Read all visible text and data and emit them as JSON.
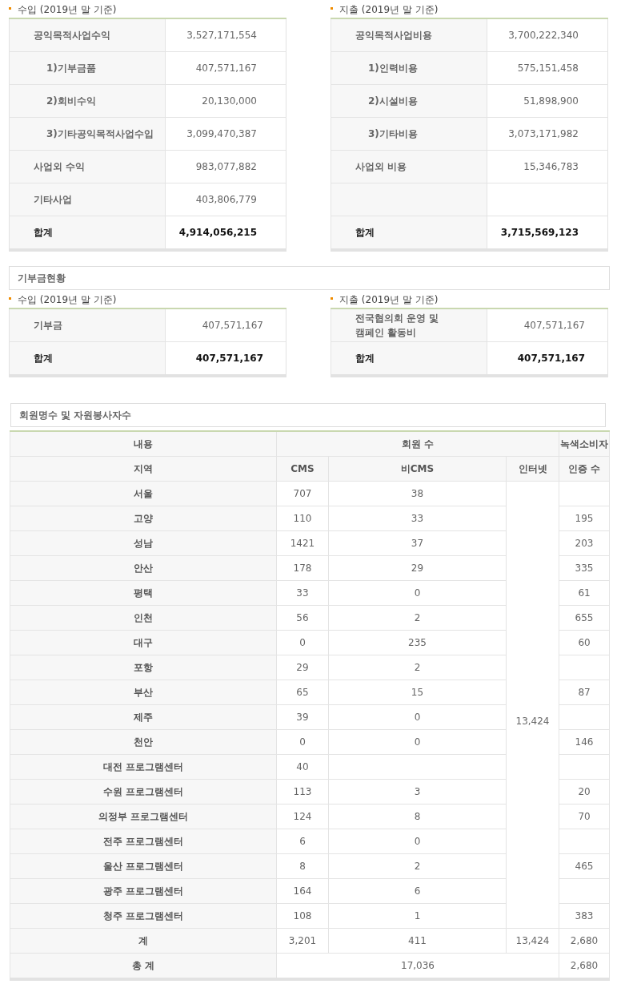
{
  "finance": {
    "income": {
      "title": "수입 (2019년 말 기준)",
      "rows": [
        {
          "kind": "item",
          "label": "공익목적사업수익",
          "value": "3,527,171,554"
        },
        {
          "kind": "subitem",
          "label": "1)기부금품",
          "value": "407,571,167"
        },
        {
          "kind": "subitem",
          "label": "2)회비수익",
          "value": "20,130,000"
        },
        {
          "kind": "subitem",
          "label": "3)기타공익목적사업수입",
          "value": "3,099,470,387"
        },
        {
          "kind": "item",
          "label": "사업외 수익",
          "value": "983,077,882"
        },
        {
          "kind": "item",
          "label": "기타사업",
          "value": "403,806,779"
        },
        {
          "kind": "total",
          "label": "합계",
          "value": "4,914,056,215"
        }
      ]
    },
    "expense": {
      "title": "지출 (2019년 말 기준)",
      "rows": [
        {
          "kind": "item",
          "label": "공익목적사업비용",
          "value": "3,700,222,340"
        },
        {
          "kind": "subitem",
          "label": "1)인력비용",
          "value": "575,151,458"
        },
        {
          "kind": "subitem",
          "label": "2)시설비용",
          "value": "51,898,900"
        },
        {
          "kind": "subitem",
          "label": "3)기타비용",
          "value": "3,073,171,982"
        },
        {
          "kind": "item",
          "label": "사업외 비용",
          "value": "15,346,783"
        },
        {
          "kind": "blank"
        },
        {
          "kind": "total",
          "label": "합계",
          "value": "3,715,569,123"
        }
      ]
    }
  },
  "donations": {
    "heading": "기부금현황",
    "income": {
      "title": "수입 (2019년 말 기준)",
      "rows": [
        {
          "kind": "item",
          "label": "기부금",
          "value": "407,571,167"
        },
        {
          "kind": "total",
          "label": "합계",
          "value": "407,571,167"
        }
      ]
    },
    "expense": {
      "title": "지출 (2019년 말 기준)",
      "rows": [
        {
          "kind": "item",
          "label": "전국협의회 운영 및\n캠페인 활동비",
          "value": "407,571,167"
        },
        {
          "kind": "total",
          "label": "합계",
          "value": "407,571,167"
        }
      ]
    }
  },
  "members": {
    "heading": "회원명수 및 자원봉사자수",
    "header_top": {
      "content": "내용",
      "members": "회원 수",
      "green": "녹색소비자"
    },
    "header_sub": {
      "region": "지역",
      "cms": "CMS",
      "non_cms": "비CMS",
      "internet": "인터넷",
      "certified": "인증 수"
    },
    "internet_total": "13,424",
    "rows": [
      {
        "region": "서울",
        "cms": "707",
        "non_cms": "38"
      },
      {
        "region": "고양",
        "cms": "110",
        "non_cms": "33",
        "certified": "195"
      },
      {
        "region": "성남",
        "cms": "1421",
        "non_cms": "37",
        "certified": "203"
      },
      {
        "region": "안산",
        "cms": "178",
        "non_cms": "29",
        "certified": "335"
      },
      {
        "region": "평택",
        "cms": "33",
        "non_cms": "0",
        "certified": "61"
      },
      {
        "region": "인천",
        "cms": "56",
        "non_cms": "2",
        "certified": "655"
      },
      {
        "region": "대구",
        "cms": "0",
        "non_cms": "235",
        "certified": "60"
      },
      {
        "region": "포항",
        "cms": "29",
        "non_cms": "2"
      },
      {
        "region": "부산",
        "cms": "65",
        "non_cms": "15",
        "certified": "87"
      },
      {
        "region": "제주",
        "cms": "39",
        "non_cms": "0"
      },
      {
        "region": "천안",
        "cms": "0",
        "non_cms": "0",
        "certified": "146"
      },
      {
        "region": "대전 프로그램센터",
        "cms": "40"
      },
      {
        "region": "수원 프로그램센터",
        "cms": "113",
        "non_cms": "3",
        "certified": "20"
      },
      {
        "region": "의정부 프로그램센터",
        "cms": "124",
        "non_cms": "8",
        "certified": "70"
      },
      {
        "region": "전주 프로그램센터",
        "cms": "6",
        "non_cms": "0"
      },
      {
        "region": "울산 프로그램센터",
        "cms": "8",
        "non_cms": "2",
        "certified": "465"
      },
      {
        "region": "광주 프로그램센터",
        "cms": "164",
        "non_cms": "6"
      },
      {
        "region": "청주 프로그램센터",
        "cms": "108",
        "non_cms": "1",
        "certified": "383"
      }
    ],
    "subtotal": {
      "label": "계",
      "cms": "3,201",
      "non_cms": "411",
      "internet": "13,424",
      "certified": "2,680"
    },
    "grand_total": {
      "label": "총 계",
      "members": "17,036",
      "certified": "2,680"
    }
  }
}
